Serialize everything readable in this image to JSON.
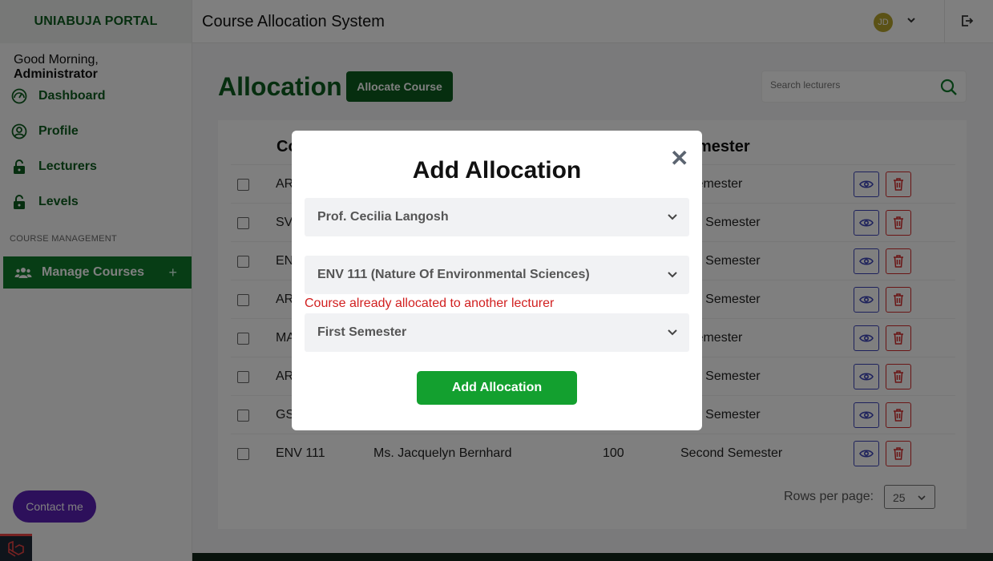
{
  "sidebar": {
    "brand": "UNIABUJA PORTAL",
    "greeting_prefix": "Good Morning, ",
    "greeting_name": "Administrator",
    "items": [
      {
        "label": "Dashboard",
        "icon": "dashboard-icon"
      },
      {
        "label": "Profile",
        "icon": "user-circle-icon"
      },
      {
        "label": "Lecturers",
        "icon": "lock-icon"
      },
      {
        "label": "Levels",
        "icon": "lock-icon"
      }
    ],
    "section_label": "COURSE MANAGEMENT",
    "manage_courses": "Manage Courses",
    "manage_plus": "+",
    "contact": "Contact me"
  },
  "header": {
    "title": "Course Allocation System",
    "avatar_initials": "JD"
  },
  "main": {
    "title": "Allocation",
    "allocate_button": "Allocate Course",
    "search_placeholder": "Search lecturers",
    "columns": [
      "Co",
      "mester"
    ],
    "rows": [
      {
        "course": "AR",
        "lecturer": "",
        "level": "",
        "semester": "t Semester"
      },
      {
        "course": "SV",
        "lecturer": "",
        "level": "",
        "semester": "ond Semester"
      },
      {
        "course": "EN",
        "lecturer": "",
        "level": "",
        "semester": "ond Semester"
      },
      {
        "course": "AR",
        "lecturer": "",
        "level": "",
        "semester": "ond Semester"
      },
      {
        "course": "MA",
        "lecturer": "",
        "level": "",
        "semester": "t Semester"
      },
      {
        "course": "AR",
        "lecturer": "",
        "level": "",
        "semester": "ond Semester"
      },
      {
        "course": "GS",
        "lecturer": "",
        "level": "",
        "semester": "ond Semester"
      },
      {
        "course": "ENV 111",
        "lecturer": "Ms. Jacquelyn Bernhard",
        "level": "100",
        "semester": "Second Semester"
      }
    ],
    "rows_per_page_label": "Rows per page:",
    "rows_per_page_value": "25"
  },
  "modal": {
    "title": "Add Allocation",
    "close": "✕",
    "lecturer_value": "Prof. Cecilia Langosh",
    "course_value": "ENV 111 (Nature Of Environmental Sciences)",
    "error": "Course already allocated to another lecturer",
    "semester_value": "First Semester",
    "submit": "Add Allocation"
  },
  "colors": {
    "brand_green": "#0d5c1e",
    "button_green": "#13a02f",
    "error_red": "#d11f1f",
    "contact_purple": "#5b21b6"
  }
}
